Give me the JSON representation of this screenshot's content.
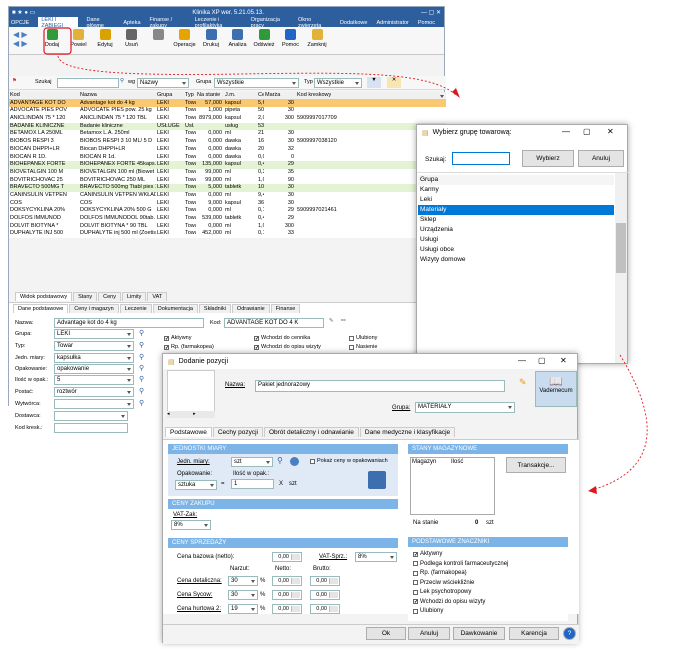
{
  "app": {
    "title": "Klinika XP wer. 5.21.05.13.",
    "menu": [
      "OPCJE",
      "LEKI I ZABIEGI",
      "Dane główne",
      "Apteka",
      "Finanse / zakupy",
      "Leczenie i profilaktyka",
      "Organizacja pracy",
      "Okno zwierzęta",
      "Dodatkowe",
      "Administrator",
      "Pomoc"
    ],
    "toolbar": [
      "Dodaj",
      "Powiel",
      "Edytuj",
      "Usuń",
      "",
      "Operacje",
      "Drukuj",
      "Analiza",
      "Odśwież",
      "Pomoc",
      "Zamknij"
    ]
  },
  "search": {
    "label": "Szukaj",
    "wg": "wg",
    "wg_value": "Nazwy",
    "grupa": "Grupa",
    "grupa_value": "Wszystkie",
    "typ": "Typ",
    "typ_value": "Wszystkie"
  },
  "grid": {
    "headers": [
      "Kod",
      "Nazwa",
      "Grupa",
      "Typ",
      "Na stanie",
      "J.m.",
      "Cena sprz.",
      "Marża",
      "Kod kreskowy"
    ],
    "rows": [
      [
        "ADVANTAGE KOT DO",
        "Advantage kot do 4 kg",
        "LEKI",
        "Towa",
        "57,000",
        "kapsul",
        "5,62",
        "30",
        ""
      ],
      [
        "ADVOCATE PIES POV",
        "ADVOCATE PIES pow. 25 kg",
        "LEKI",
        "Towa",
        "1,000",
        "pipeta",
        "50,09",
        "30",
        ""
      ],
      [
        "ANICLINDAN 75 * 120",
        "ANICLINDAN 75 * 120 TBL",
        "LEKI",
        "Towa",
        "8979,000",
        "kapsul",
        "2,00",
        "300",
        "5909997017709"
      ],
      [
        "BADANIE KLINICZNE",
        "Badanie kliniczne",
        "USŁUGE",
        "Usł.",
        "",
        "usług",
        "53,24",
        "",
        ""
      ],
      [
        "BETAMOX LA 250ML",
        "Betamox L.A. 250ml",
        "LEKI",
        "Towa",
        "0,000",
        "ml",
        "21,00",
        "30",
        ""
      ],
      [
        "BIOBOS RESPI 3",
        "BIOBOS RESPI 3 10 ML/ 5 D",
        "LEKI",
        "Towa",
        "0,000",
        "dawka",
        "16,99",
        "30",
        "5909997038120"
      ],
      [
        "BIOCAN DHPPI+LR",
        "Biocan DHPPI+LR",
        "LEKI",
        "Towa",
        "0,000",
        "dawka",
        "20,00",
        "32",
        ""
      ],
      [
        "BIOCAN R 1D.",
        "BIOCAN R 1d.",
        "LEKI",
        "Towa",
        "0,000",
        "dawka",
        "0,00",
        "0",
        ""
      ],
      [
        "BIOHEPANEX FORTE",
        "BIOHEPANEX FORTE 45kaps. (Biow",
        "LEKI",
        "Towa",
        "135,000",
        "kapsul",
        "0,49",
        "29",
        ""
      ],
      [
        "BIOVETALGIN 100 M",
        "BIOVETALGIN 100 ml (Biowet Drw",
        "LEKI",
        "Towa",
        "99,000",
        "ml",
        "0,33",
        "35",
        ""
      ],
      [
        "BOVITRICHOVAC 25",
        "BOVITRICHOVAC 250 ML",
        "LEKI",
        "Towa",
        "99,000",
        "ml",
        "1,00",
        "90",
        ""
      ],
      [
        "BRAVECTO 500MG T",
        "BRAVECTO 500mg Ttabl pies 10-2",
        "LEKI",
        "Towa",
        "5,000",
        "tabletk",
        "108,15",
        "30",
        ""
      ],
      [
        "CANINSULIN VETPEN",
        "CANINSULIN VETPEN WKŁADY 40",
        "LEKI",
        "Towa",
        "0,000",
        "ml",
        "9,40",
        "30",
        ""
      ],
      [
        "COS",
        "COS",
        "LEKI",
        "Towa",
        "9,000",
        "kapsul",
        "36,78",
        "30",
        ""
      ],
      [
        "DOKSYCYKLINA 20%",
        "DOKSYCYKLINA 20% 500 G",
        "LEKI",
        "Towa",
        "0,000",
        "ml",
        "0,10",
        "29",
        "5909997021461"
      ],
      [
        "DOLFOS IMMUNOD",
        "DOLFOS IMMUNODOL 90tab.",
        "LEKI",
        "Towa",
        "539,000",
        "tabletk",
        "0,49",
        "29",
        ""
      ],
      [
        "DOLVIT BIOTYNA *",
        "DOLVIT BIOTYNA * 90 TBL",
        "LEKI",
        "Towa",
        "0,000",
        "ml",
        "1,00",
        "300",
        ""
      ],
      [
        "DUPHALYTE INJ 500",
        "DUPHALYTE inj 500 ml (Zoetis)",
        "LEKI",
        "Towa",
        "452,000",
        "ml",
        "0,17",
        "33",
        ""
      ]
    ]
  },
  "tabs1": [
    "Widok podstawowy",
    "Stany",
    "Ceny",
    "Limity",
    "VAT"
  ],
  "tabs2": [
    "Dane podstawowe",
    "Ceny i magazyn",
    "Leczenie",
    "Dokumentacja",
    "Składniki",
    "Odrawianie",
    "Finanse"
  ],
  "detail": {
    "nazwa_l": "Nazwa:",
    "nazwa": "Advantage kot do 4 kg",
    "kod_l": "Kod:",
    "kod": "ADVANTAGE KOT DO 4 K",
    "grupa_l": "Grupa:",
    "grupa": "LEKI",
    "typ_l": "Typ:",
    "typ": "Towar",
    "jm_l": "Jedn. miary:",
    "jm": "kapsułka",
    "op_l": "Opakowanie:",
    "op": "opakowanie",
    "il_l": "Ilość w opak.:",
    "il": "5",
    "post_l": "Postać:",
    "post": "roztwór",
    "wyt_l": "Wytwórca:",
    "dost_l": "Dostawca:",
    "kodk_l": "Kod kresk.:",
    "checks": [
      "Aktywny",
      "Rp. (farmakopea)",
      "Podlega kontroli farmac.",
      "Lek psychotropowy",
      "Przeciw wściekliźnie",
      "Wchodzi do cennika",
      "Wchodzi do opisu wizyty",
      "Uzmowany w inwentaryzacji",
      "Zostawiany do zastosowania",
      "Ulubiony",
      "Nasienie",
      "Monitorowany",
      "Usługa obca"
    ]
  },
  "dlg_grupa": {
    "title": "Wybierz grupę towarową:",
    "szukaj": "Szukaj:",
    "wybierz": "Wybierz",
    "anuluj": "Anuluj",
    "header": "Grupa",
    "items": [
      "Karmy",
      "Leki",
      "Materiały",
      "Sklep",
      "Urządzenia",
      "Usługi",
      "Usługi obce",
      "Wizyty domowe"
    ],
    "selected": 2
  },
  "dlg_poz": {
    "title": "Dodanie pozycji",
    "nazwa_l": "Nazwa:",
    "nazwa": "Pakiet jednorazowy",
    "grupa_l": "Grupa:",
    "grupa": "MATERIAŁY",
    "vademecum": "Vademecum",
    "tabs": [
      "Podstawowe",
      "Cechy pozycji",
      "Obrót detaliczny i odnawianie",
      "Dane medyczne i klasyfikacje"
    ],
    "sec_jm": "JEDNOSTKI MIARY",
    "jm_l": "Jedn. miary:",
    "jm": "szt",
    "pokaz": "Pokaż ceny w opakowaniach",
    "op_l": "Opakowanie:",
    "op": "sztuka",
    "il_l": "Ilość w opak.:",
    "il": "1",
    "x": "X",
    "szt": "szt",
    "sec_zak": "CENY ZAKUPU",
    "vatz_l": "VAT-Zak:",
    "vatz": "8%",
    "sec_sprz": "CENY SPRZEDAŻY",
    "baz_l": "Cena bazowa (netto):",
    "baz": "0,00",
    "vats_l": "VAT-Sprz.:",
    "vats": "8%",
    "narzut": "Narzut:",
    "netto": "Netto:",
    "brutto": "Brutto:",
    "prices": [
      {
        "l": "Cena detaliczna:",
        "n": "30",
        "net": "0,00",
        "br": "0,00"
      },
      {
        "l": "Cena Sycow:",
        "n": "30",
        "net": "0,00",
        "br": "0,00"
      },
      {
        "l": "Cena hurtowa 2:",
        "n": "19",
        "net": "0,00",
        "br": "0,00"
      }
    ],
    "pct": "%",
    "sec_stany": "STANY MAGAZYNOWE",
    "mag": "Magazyn",
    "ilosc": "Ilość",
    "transakcje": "Transakcje...",
    "na_stanie_l": "Na stanie",
    "na_stanie": "0",
    "szt2": "szt",
    "sec_znaczniki": "PODSTAWOWE ZNACZNIKI",
    "checks": [
      {
        "t": "Aktywny",
        "c": true
      },
      {
        "t": "Podlega kontroli farmaceutycznej",
        "c": false
      },
      {
        "t": "Rp. (farmakopea)",
        "c": false
      },
      {
        "t": "Przeciw wściekliźnie",
        "c": false
      },
      {
        "t": "Lek psychotropowy",
        "c": false
      },
      {
        "t": "Wchodzi do opisu wizyty",
        "c": true
      },
      {
        "t": "Ulubiony",
        "c": false
      }
    ],
    "ok": "Ok",
    "anuluj": "Anuluj",
    "dawkowanie": "Dawkowanie",
    "karencja": "Karencja",
    "help": "?"
  },
  "colors": {
    "accent": "#2d5f9f",
    "select": "#0078d7",
    "section": "#7db4e7",
    "arrow": "#e0161e"
  }
}
